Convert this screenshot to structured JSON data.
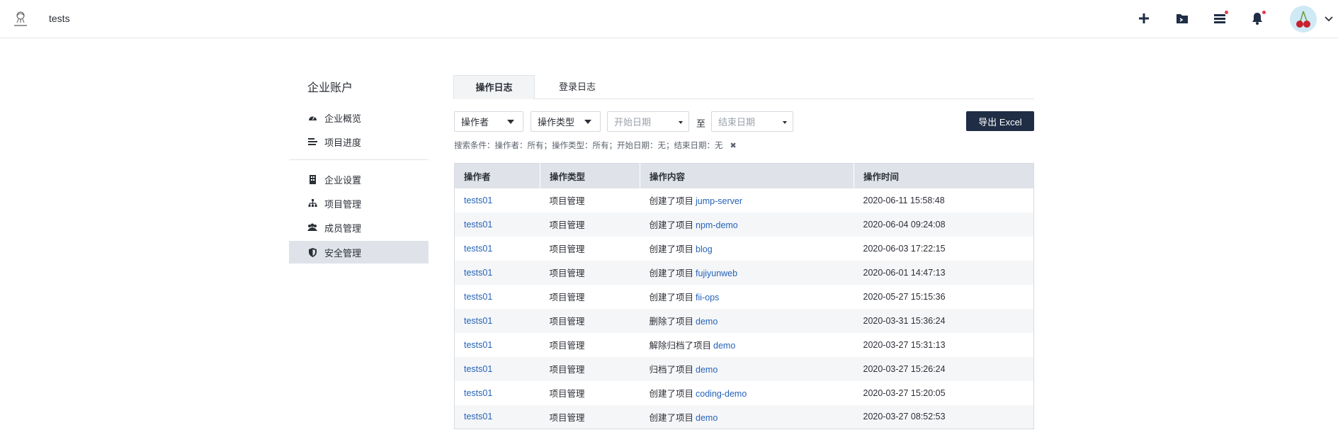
{
  "header": {
    "team_name": "tests",
    "icons": [
      "plus-icon",
      "terminal-folder-icon",
      "server-list-icon",
      "bell-icon"
    ],
    "notification_color": "#e8384f"
  },
  "sidebar": {
    "title": "企业账户",
    "items": [
      {
        "label": "企业概览",
        "icon": "dashboard-icon"
      },
      {
        "label": "项目进度",
        "icon": "list-icon"
      },
      {
        "label": "企业设置",
        "icon": "building-icon"
      },
      {
        "label": "项目管理",
        "icon": "sitemap-icon"
      },
      {
        "label": "成员管理",
        "icon": "users-icon"
      },
      {
        "label": "安全管理",
        "icon": "shield-icon",
        "active": true
      }
    ]
  },
  "tabs": [
    {
      "label": "操作日志",
      "active": true
    },
    {
      "label": "登录日志",
      "active": false
    }
  ],
  "filters": {
    "operator": "操作者",
    "op_type": "操作类型",
    "start_date_placeholder": "开始日期",
    "to": "至",
    "end_date_placeholder": "结束日期",
    "export_label": "导出 Excel"
  },
  "search_conditions": "搜索条件：操作者：所有；操作类型：所有；开始日期：无；结束日期：无",
  "table": {
    "columns": [
      "操作者",
      "操作类型",
      "操作内容",
      "操作时间"
    ],
    "rows": [
      {
        "user": "tests01",
        "type": "项目管理",
        "action": "创建了项目",
        "target": "jump-server",
        "time": "2020-06-11 15:58:48"
      },
      {
        "user": "tests01",
        "type": "项目管理",
        "action": "创建了项目",
        "target": "npm-demo",
        "time": "2020-06-04 09:24:08"
      },
      {
        "user": "tests01",
        "type": "项目管理",
        "action": "创建了项目",
        "target": "blog",
        "time": "2020-06-03 17:22:15"
      },
      {
        "user": "tests01",
        "type": "项目管理",
        "action": "创建了项目",
        "target": "fujiyunweb",
        "time": "2020-06-01 14:47:13"
      },
      {
        "user": "tests01",
        "type": "项目管理",
        "action": "创建了项目",
        "target": "fii-ops",
        "time": "2020-05-27 15:15:36"
      },
      {
        "user": "tests01",
        "type": "项目管理",
        "action": "删除了项目",
        "target": "demo",
        "time": "2020-03-31 15:36:24"
      },
      {
        "user": "tests01",
        "type": "项目管理",
        "action": "解除归档了项目",
        "target": "demo",
        "time": "2020-03-27 15:31:13"
      },
      {
        "user": "tests01",
        "type": "项目管理",
        "action": "归档了项目",
        "target": "demo",
        "time": "2020-03-27 15:26:24"
      },
      {
        "user": "tests01",
        "type": "项目管理",
        "action": "创建了项目",
        "target": "coding-demo",
        "time": "2020-03-27 15:20:05"
      },
      {
        "user": "tests01",
        "type": "项目管理",
        "action": "创建了项目",
        "target": "demo",
        "time": "2020-03-27 08:52:53"
      }
    ]
  },
  "colors": {
    "link": "#2563b8",
    "export_button": "#1f2d45",
    "header_row": "#dfe3e9",
    "active_sidebar": "#dfe3e9"
  }
}
